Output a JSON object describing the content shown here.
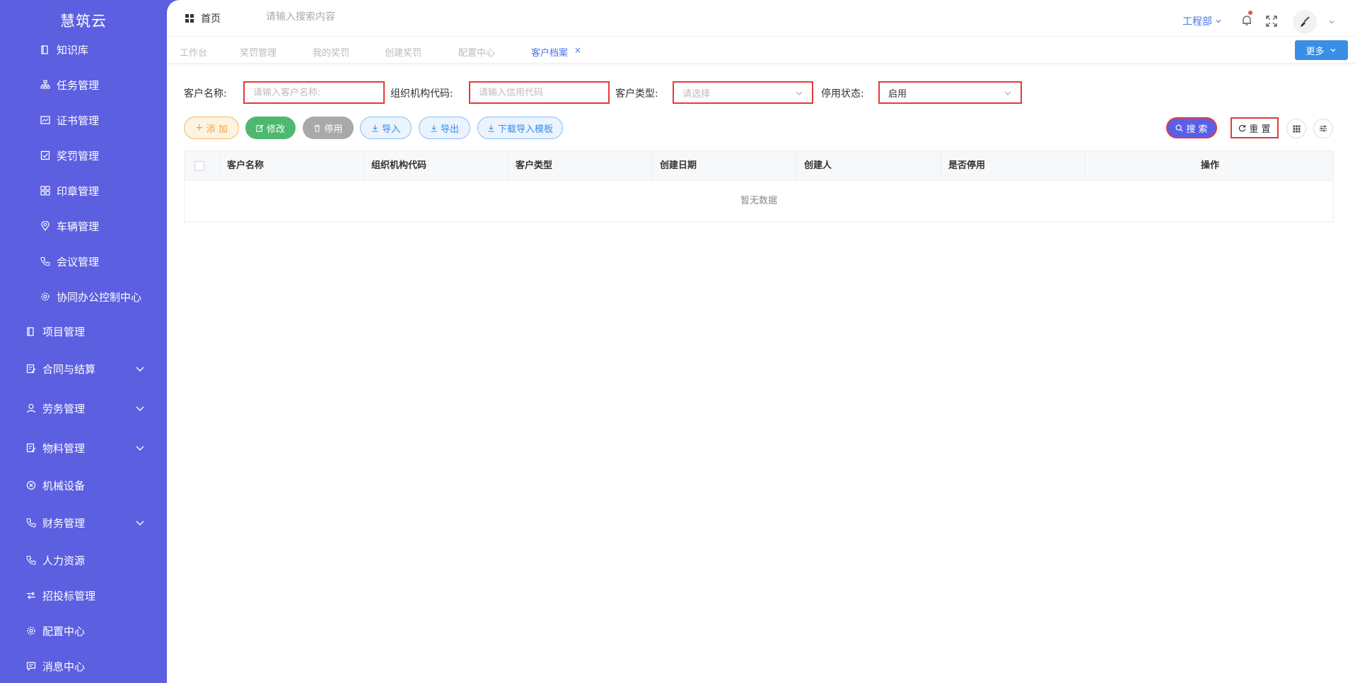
{
  "app": {
    "brand": "慧筑云"
  },
  "sidebar": {
    "items": [
      {
        "label": "知识库",
        "icon": "book-icon",
        "level": "sub",
        "expandable": false
      },
      {
        "label": "任务管理",
        "icon": "org-tree-icon",
        "level": "sub",
        "expandable": false
      },
      {
        "label": "证书管理",
        "icon": "certificate-icon",
        "level": "sub",
        "expandable": false
      },
      {
        "label": "奖罚管理",
        "icon": "checkbox-icon",
        "level": "sub",
        "expandable": false
      },
      {
        "label": "印章管理",
        "icon": "grid-icon",
        "level": "sub",
        "expandable": false
      },
      {
        "label": "车辆管理",
        "icon": "location-pin-icon",
        "level": "sub",
        "expandable": false
      },
      {
        "label": "会议管理",
        "icon": "phone-icon",
        "level": "sub",
        "expandable": false
      },
      {
        "label": "协同办公控制中心",
        "icon": "gear-icon",
        "level": "sub",
        "expandable": false
      },
      {
        "label": "项目管理",
        "icon": "book-icon",
        "level": "top",
        "expandable": false
      },
      {
        "label": "合同与结算",
        "icon": "edit-doc-icon",
        "level": "top",
        "expandable": true
      },
      {
        "label": "劳务管理",
        "icon": "user-icon",
        "level": "top",
        "expandable": true
      },
      {
        "label": "物料管理",
        "icon": "edit-doc-icon",
        "level": "top",
        "expandable": true
      },
      {
        "label": "机械设备",
        "icon": "circle-x-icon",
        "level": "top",
        "expandable": false
      },
      {
        "label": "财务管理",
        "icon": "phone-icon",
        "level": "top",
        "expandable": true
      },
      {
        "label": "人力资源",
        "icon": "phone-icon",
        "level": "top",
        "expandable": false
      },
      {
        "label": "招投标管理",
        "icon": "exchange-icon",
        "level": "top",
        "expandable": false
      },
      {
        "label": "配置中心",
        "icon": "gear-icon",
        "level": "top",
        "expandable": false
      },
      {
        "label": "消息中心",
        "icon": "message-icon",
        "level": "top",
        "expandable": false
      }
    ]
  },
  "header": {
    "home_label": "首页",
    "search_placeholder": "请输入搜索内容",
    "department": "工程部"
  },
  "tabs": {
    "items": [
      {
        "label": "工作台",
        "active": false
      },
      {
        "label": "奖罚管理",
        "active": false
      },
      {
        "label": "我的奖罚",
        "active": false
      },
      {
        "label": "创建奖罚",
        "active": false
      },
      {
        "label": "配置中心",
        "active": false
      },
      {
        "label": "客户档案",
        "active": true
      }
    ],
    "close_glyph": "×",
    "more_label": "更多"
  },
  "filters": {
    "customer_name_label": "客户名称:",
    "customer_name_placeholder": "请输入客户名称:",
    "org_code_label": "组织机构代码:",
    "org_code_placeholder": "请输入信用代码",
    "customer_type_label": "客户类型:",
    "customer_type_placeholder": "请选择",
    "status_label": "停用状态:",
    "status_value": "启用"
  },
  "toolbar": {
    "add_label": "添 加",
    "edit_label": "修改",
    "disable_label": "停用",
    "import_label": "导入",
    "export_label": "导出",
    "template_label": "下载导入模板",
    "search_label": "搜 索",
    "reset_label": "重 置"
  },
  "table": {
    "columns": [
      "客户名称",
      "组织机构代码",
      "客户类型",
      "创建日期",
      "创建人",
      "是否停用",
      "操作"
    ],
    "rows": [],
    "empty_text": "暂无数据"
  },
  "colors": {
    "sidebar_bg": "#5c5fe0",
    "accent": "#4a74e8",
    "primary_button": "#3a8ee6",
    "search_button": "#5b5fe6",
    "edit_button": "#4fb86f",
    "add_button_text": "#f0a433",
    "highlight_border": "#e23b3b"
  }
}
